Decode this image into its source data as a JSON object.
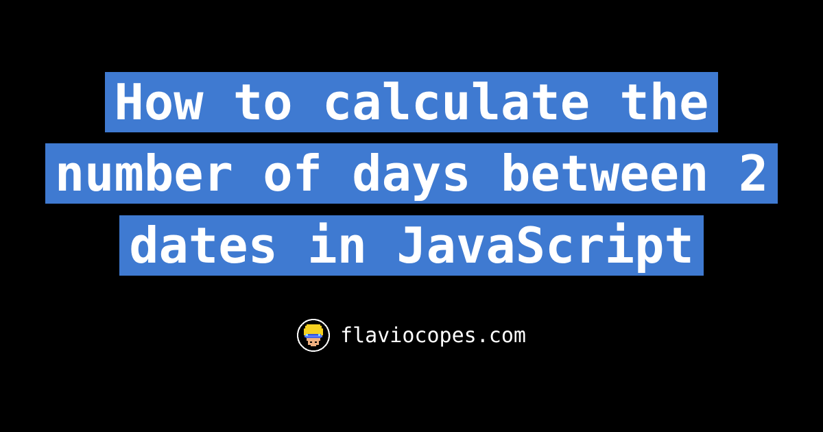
{
  "card": {
    "title": "How to calculate the number of days between 2 dates in JavaScript",
    "domain": "flaviocopes.com"
  },
  "colors": {
    "background": "#000000",
    "highlight": "#3f7ad1",
    "text": "#ffffff"
  }
}
